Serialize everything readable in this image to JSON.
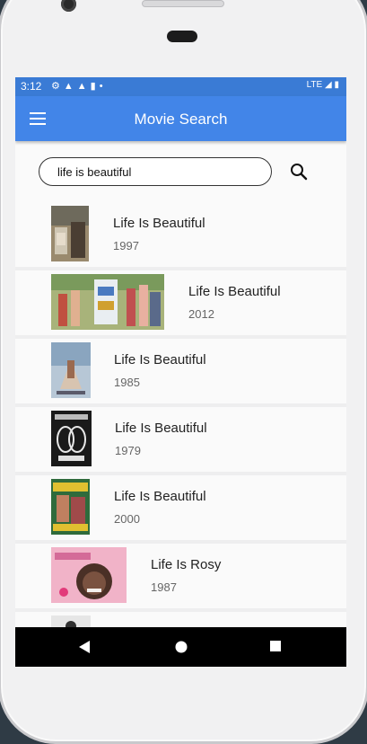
{
  "status_bar": {
    "time": "3:12",
    "network": "LTE"
  },
  "app_bar": {
    "title": "Movie Search"
  },
  "search": {
    "value": "life is beautiful"
  },
  "results": [
    {
      "title": "Life Is Beautiful",
      "year": "1997"
    },
    {
      "title": "Life Is Beautiful",
      "year": "2012"
    },
    {
      "title": "Life Is Beautiful",
      "year": "1985"
    },
    {
      "title": "Life Is Beautiful",
      "year": "1979"
    },
    {
      "title": "Life Is Beautiful",
      "year": "2000"
    },
    {
      "title": "Life Is Rosy",
      "year": "1987"
    }
  ],
  "colors": {
    "status_bar": "#3a7bd5",
    "app_bar": "#4285e8",
    "list_background": "#fafafa",
    "nav_bar": "#000000"
  },
  "icons": [
    "menu-icon",
    "search-icon",
    "back-icon",
    "home-icon",
    "recents-icon",
    "lte-icon",
    "signal-icon",
    "battery-icon"
  ]
}
